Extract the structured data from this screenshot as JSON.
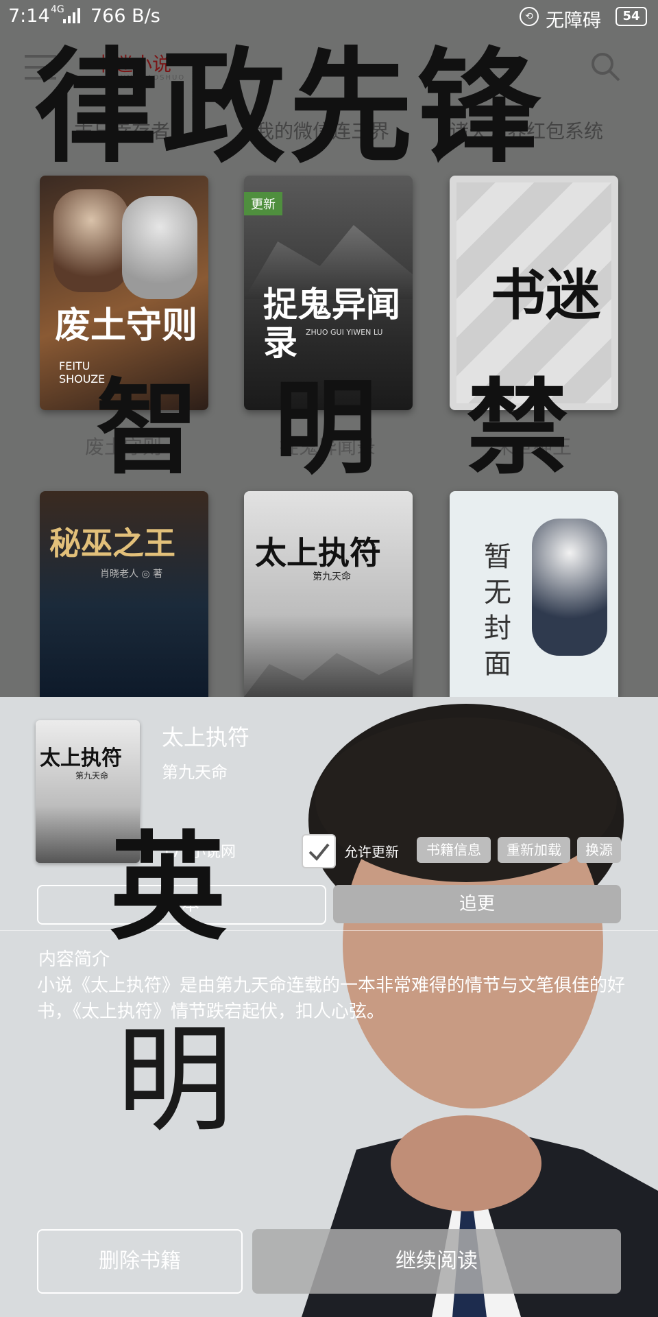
{
  "status_bar": {
    "time": "7:14",
    "network": "4G",
    "speed": "766 B/s",
    "accessibility": "无障碍",
    "battery": "54"
  },
  "header": {
    "logo_text": "书迷小说",
    "logo_sub": "SHUMIXIAOSHUO"
  },
  "categories": [
    "末日幸存者",
    "我的微信连三界",
    "诸天万界红包系统"
  ],
  "watermark": {
    "top_line": "律政先锋",
    "mid_chars": [
      "智",
      "明",
      "禁"
    ],
    "sheet_chars": [
      "英",
      "明"
    ]
  },
  "books_row1": [
    {
      "title": "废土守则",
      "cover_art": "废土守则",
      "cover_sub": "FEITU SHOUZE"
    },
    {
      "title": "捉鬼异闻录",
      "cover_art": "捉鬼异闻录",
      "cover_sub": "ZHUO GUI YIWEN LU",
      "badge": "更新"
    },
    {
      "title": "末世神王",
      "cover_art": "书迷",
      "cover_sub": ""
    }
  ],
  "books_row2": [
    {
      "title": "秘巫之王",
      "cover_art": "秘巫之王",
      "cover_sub": "肖晓老人 ◎ 著"
    },
    {
      "title": "太上执符",
      "cover_art": "太上执符",
      "cover_sub": "第九天命"
    },
    {
      "title": "暂无封面",
      "cover_art": "暂无封面",
      "cover_sub": ""
    }
  ],
  "sheet": {
    "title": "太上执符",
    "author": "第九天命",
    "source": "171小说网",
    "cover_art": "太上执符",
    "cover_sub": "第九天命",
    "allow_update_label": "允许更新",
    "book_info": "书籍信息",
    "reload": "重新加载",
    "change_source": "换源",
    "status_complete": "完本",
    "follow": "追更",
    "intro_label": "内容简介",
    "intro_text": "小说《太上执符》是由第九天命连载的一本非常难得的情节与文笔俱佳的好书，《太上执符》情节跌宕起伏，扣人心弦。",
    "delete_button": "删除书籍",
    "continue_button": "继续阅读"
  }
}
